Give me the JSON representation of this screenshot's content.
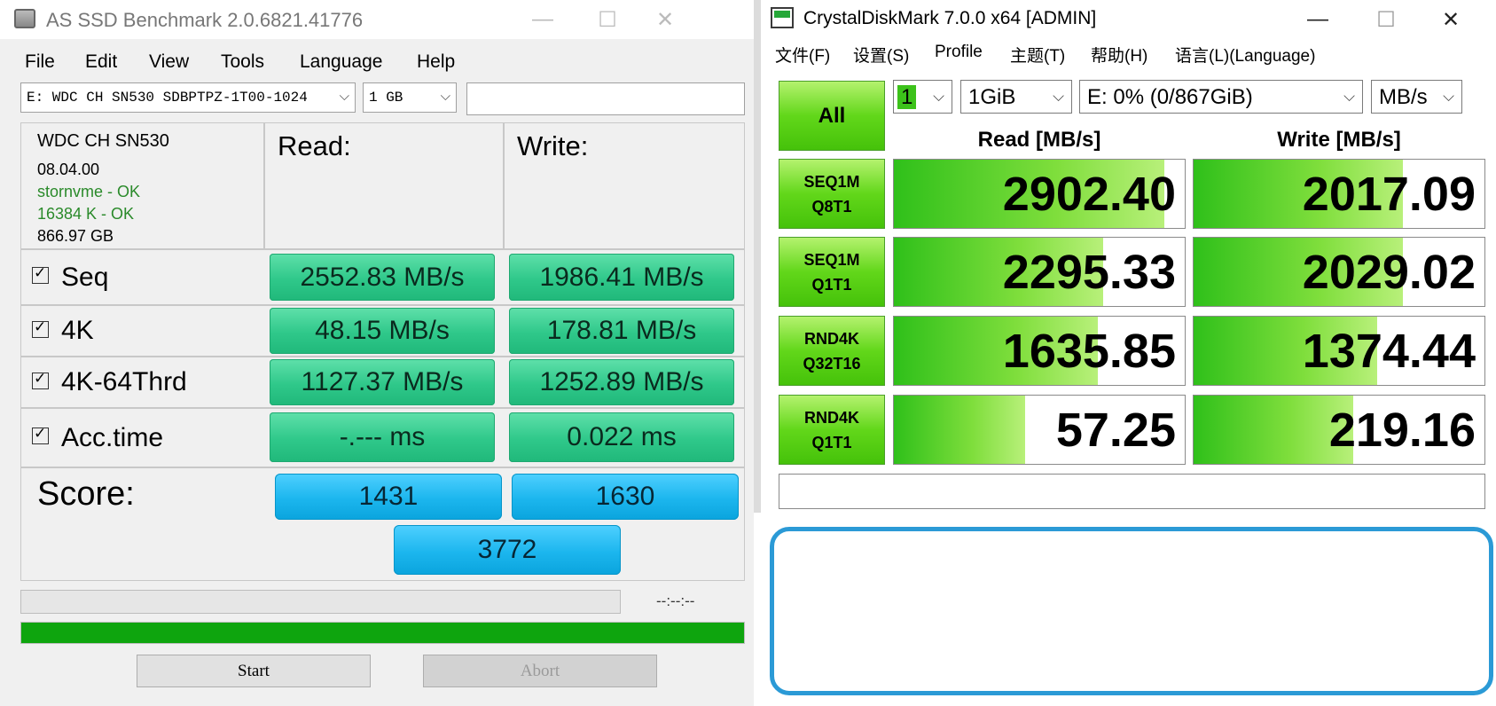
{
  "asssd": {
    "title": "AS SSD Benchmark 2.0.6821.41776",
    "menu": [
      "File",
      "Edit",
      "View",
      "Tools",
      "Language",
      "Help"
    ],
    "drive_select": "E: WDC CH SN530 SDBPTPZ-1T00-1024",
    "size_select": "1 GB",
    "path_field": "",
    "info": {
      "model": "WDC CH SN530",
      "firmware": "08.04.00",
      "driver": "stornvme - OK",
      "alignment": "16384 K - OK",
      "capacity": "866.97 GB"
    },
    "read_header": "Read:",
    "write_header": "Write:",
    "rows": [
      {
        "label": "Seq",
        "read": "2552.83 MB/s",
        "write": "1986.41 MB/s"
      },
      {
        "label": "4K",
        "read": "48.15 MB/s",
        "write": "178.81 MB/s"
      },
      {
        "label": "4K-64Thrd",
        "read": "1127.37 MB/s",
        "write": "1252.89 MB/s"
      },
      {
        "label": "Acc.time",
        "read": "-.--- ms",
        "write": "0.022 ms"
      }
    ],
    "score_label": "Score:",
    "score_read": "1431",
    "score_write": "1630",
    "score_total": "3772",
    "time_text": "--:--:--",
    "progress_fraction": 1.0,
    "start_label": "Start",
    "abort_label": "Abort",
    "colors": {
      "result_green": "#2fc88a",
      "score_blue": "#1cb6ee",
      "progress_green": "#0ea50e"
    }
  },
  "cdm": {
    "title": "CrystalDiskMark 7.0.0 x64 [ADMIN]",
    "menu": [
      "文件(F)",
      "设置(S)",
      "Profile",
      "主题(T)",
      "帮助(H)",
      "语言(L)(Language)"
    ],
    "all_button": "All",
    "count_select": "1",
    "size_select": "1GiB",
    "drive_select": "E: 0% (0/867GiB)",
    "unit_select": "MB/s",
    "read_header": "Read [MB/s]",
    "write_header": "Write [MB/s]",
    "tests": [
      {
        "name": "SEQ1M",
        "params": "Q8T1",
        "read": "2902.40",
        "write": "2017.09",
        "read_fill": 0.93,
        "write_fill": 0.72
      },
      {
        "name": "SEQ1M",
        "params": "Q1T1",
        "read": "2295.33",
        "write": "2029.02",
        "read_fill": 0.72,
        "write_fill": 0.72
      },
      {
        "name": "RND4K",
        "params": "Q32T16",
        "read": "1635.85",
        "write": "1374.44",
        "read_fill": 0.7,
        "write_fill": 0.63
      },
      {
        "name": "RND4K",
        "params": "Q1T1",
        "read": "57.25",
        "write": "219.16",
        "read_fill": 0.45,
        "write_fill": 0.55
      }
    ],
    "comment": "",
    "colors": {
      "button_green": "#62d71a",
      "bar_green": "#2fc01a",
      "highlight_blue": "#2b9ad6"
    }
  }
}
